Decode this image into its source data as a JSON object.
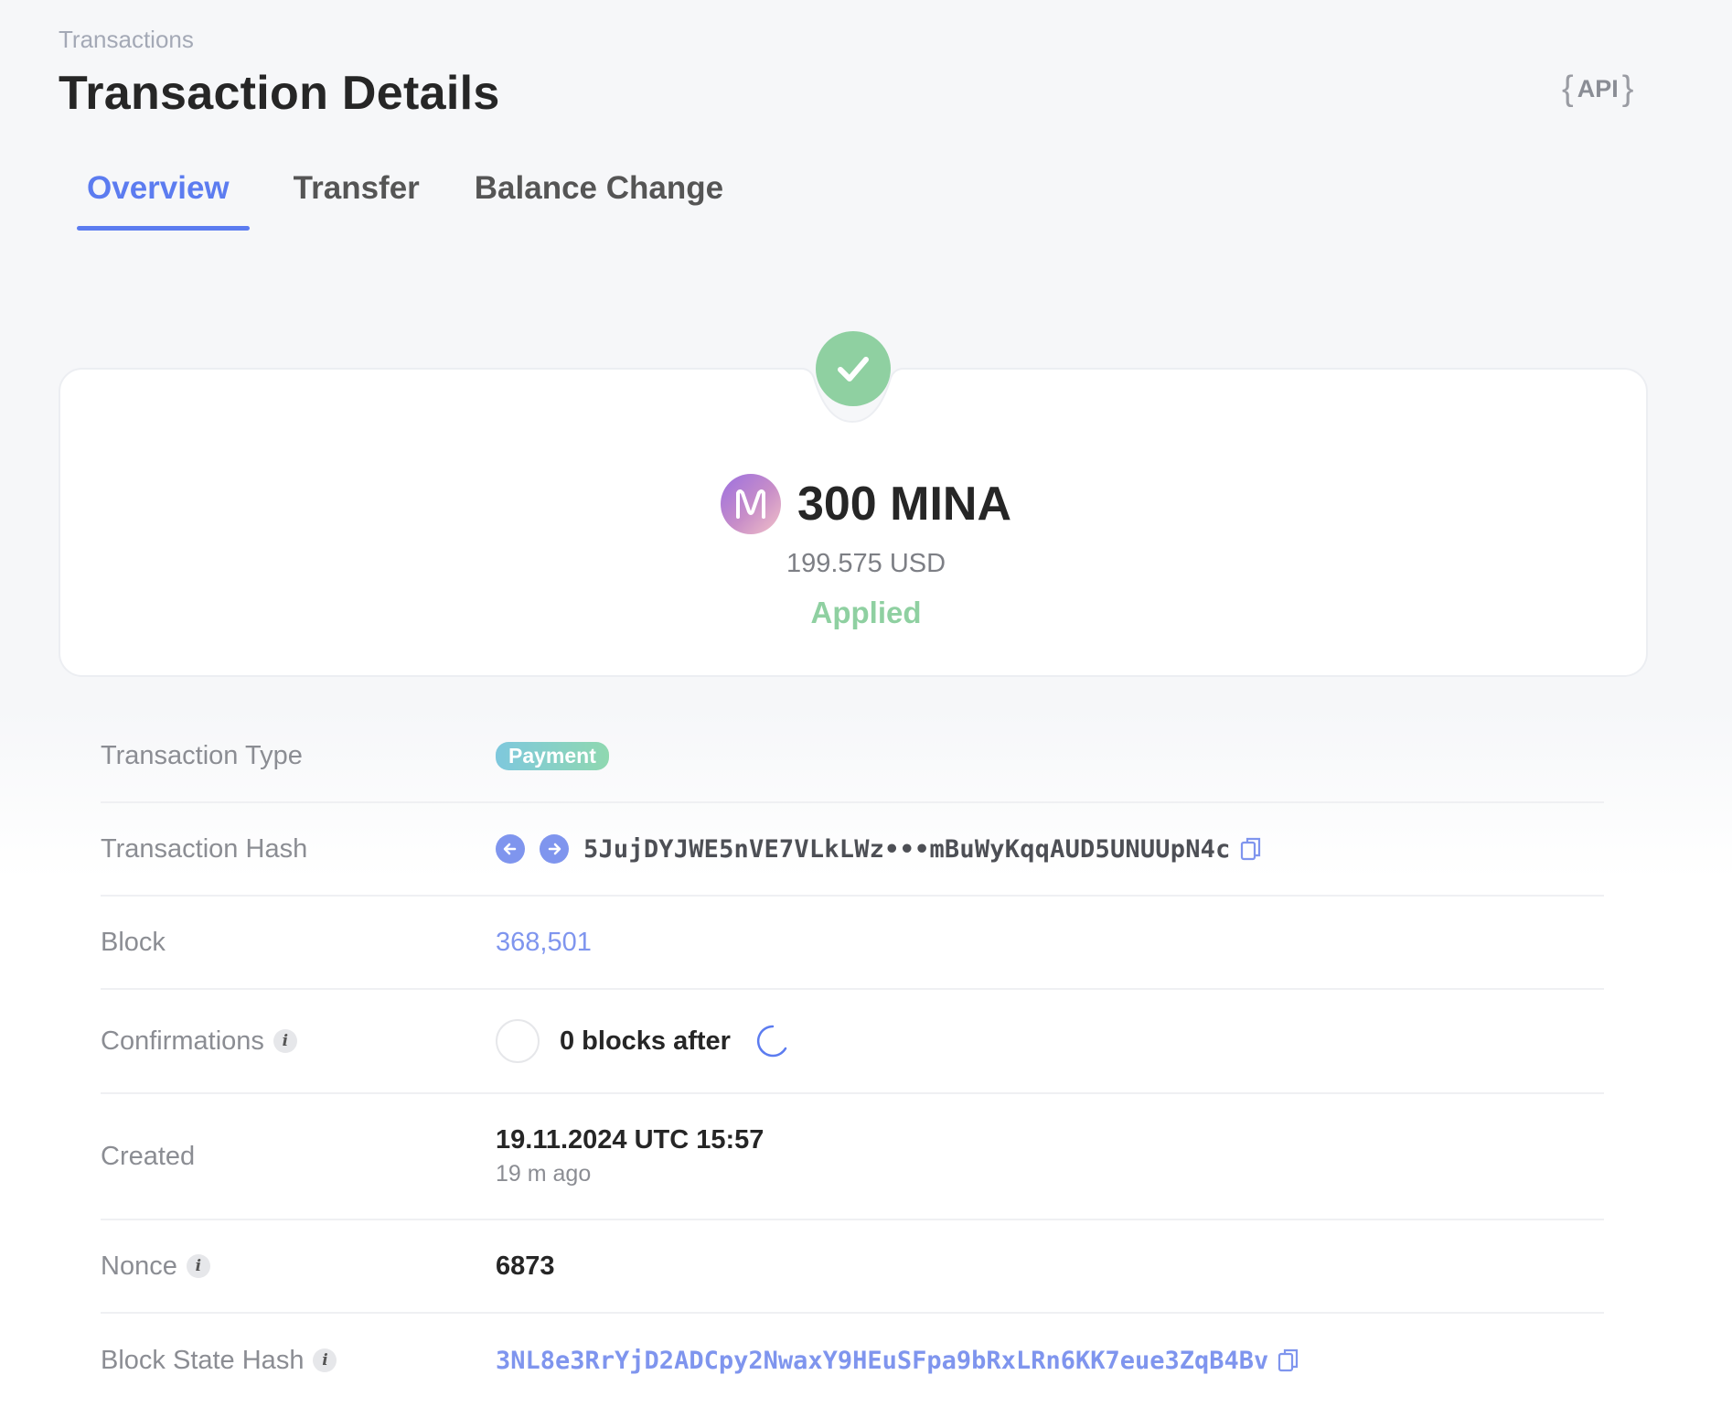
{
  "breadcrumb": "Transactions",
  "page_title": "Transaction Details",
  "api_button": {
    "label": "API"
  },
  "tabs": [
    {
      "label": "Overview",
      "active": true
    },
    {
      "label": "Transfer",
      "active": false
    },
    {
      "label": "Balance Change",
      "active": false
    }
  ],
  "summary": {
    "amount": "300 MINA",
    "usd": "199.575 USD",
    "status": "Applied",
    "token_icon": "mina-logo-icon",
    "status_icon": "checkmark-icon"
  },
  "details": {
    "transaction_type": {
      "label": "Transaction Type",
      "value": "Payment"
    },
    "transaction_hash": {
      "label": "Transaction Hash",
      "value": "5JujDYJWE5nVE7VLkLWz•••mBuWyKqqAUD5UNUUpN4c"
    },
    "block": {
      "label": "Block",
      "value": "368,501"
    },
    "confirmations": {
      "label": "Confirmations",
      "value": "0 blocks after"
    },
    "created": {
      "label": "Created",
      "value": "19.11.2024 UTC 15:57",
      "relative": "19 m ago"
    },
    "nonce": {
      "label": "Nonce",
      "value": "6873"
    },
    "block_state_hash": {
      "label": "Block State Hash",
      "value": "3NL8e3RrYjD2ADCpy2NwaxY9HEuSFpa9bRxLRn6KK7eue3ZqB4Bv"
    }
  },
  "colors": {
    "accent": "#5c7cf0",
    "link": "#7f95ee",
    "success": "#8fd0a1",
    "badge_gradient": [
      "#7ec8dd",
      "#8fd8b0"
    ]
  }
}
